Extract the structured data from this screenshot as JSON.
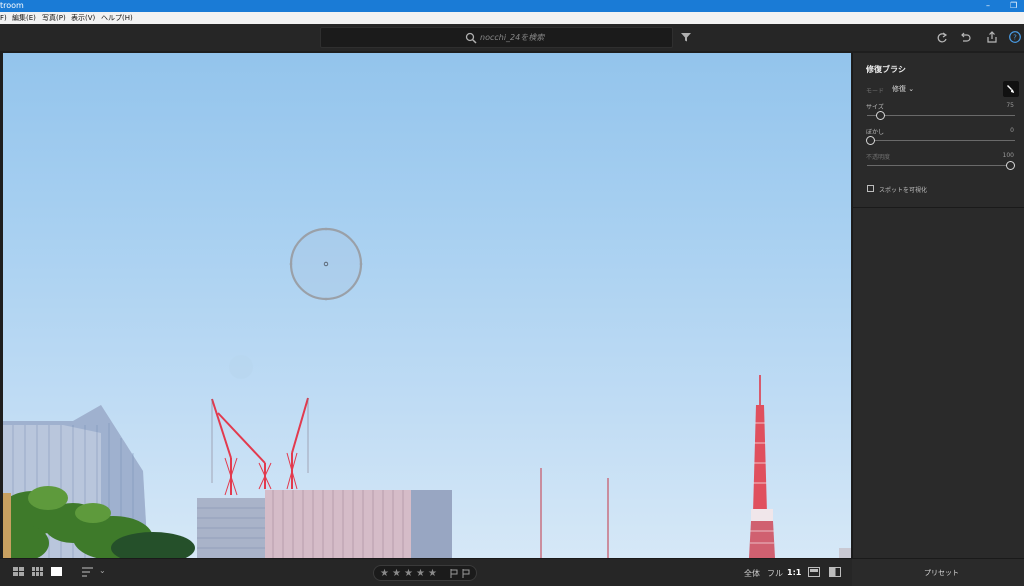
{
  "window": {
    "title": "troom",
    "controls": [
      "–",
      "❐"
    ]
  },
  "menu": {
    "items": [
      "F)",
      "編集(E)",
      "写真(P)",
      "表示(V)",
      "ヘルプ(H)"
    ]
  },
  "toolbar": {
    "search_placeholder": "nocchi_24を検索",
    "icons": [
      "filter-icon",
      "redo-icon",
      "undo-icon",
      "share-icon",
      "help-icon"
    ]
  },
  "panel": {
    "title": "修復ブラシ",
    "mode_label": "モード",
    "mode_value": "修復",
    "size_label": "サイズ",
    "size_value": "75",
    "feather_label": "ぼかし",
    "feather_value": "0",
    "opacity_label": "不透明度",
    "opacity_value": "100",
    "visualize_label": "スポットを可視化",
    "slider_levels": {
      "size": 0.07,
      "feather": 0.0,
      "opacity": 1.0
    }
  },
  "bottombar": {
    "zoom_fit": "全体",
    "zoom_fill": "フル",
    "zoom_1to1": "1:1",
    "presets_label": "プリセット",
    "rating_stars": 5
  },
  "colors": {
    "titlebar": "#1a7bd6",
    "panel_bg": "#2a2a2a",
    "toolbar_bg": "#262626"
  }
}
